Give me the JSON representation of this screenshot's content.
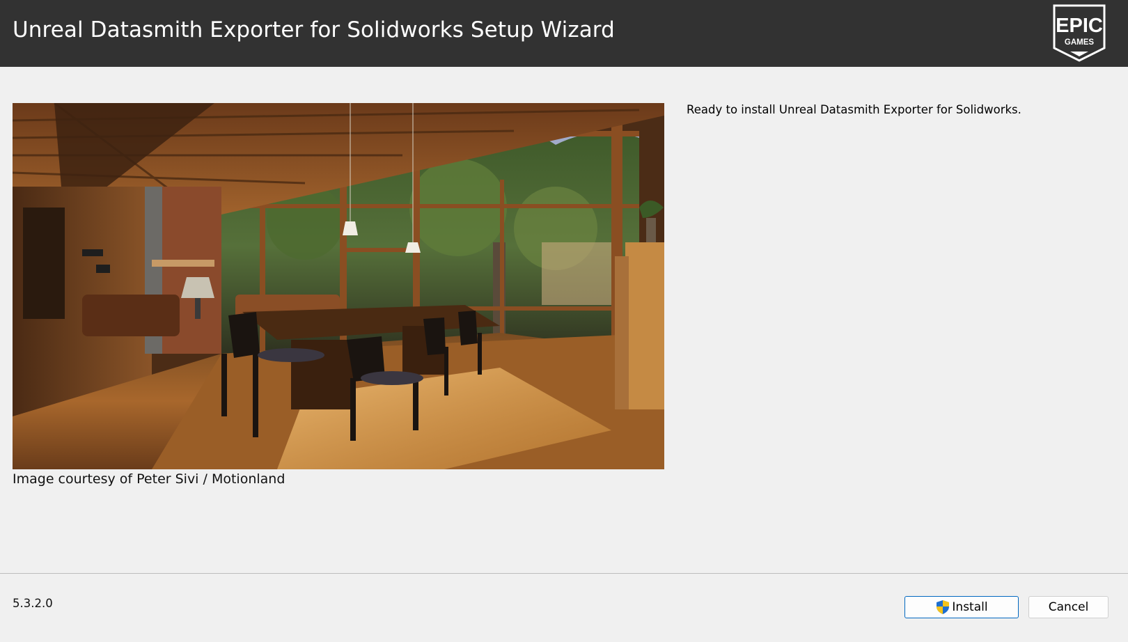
{
  "window": {
    "title": "Unreal Datasmith Exporter for Solidworks Setup Wizard"
  },
  "logo": {
    "line1": "EPIC",
    "line2": "GAMES",
    "icon": "epic-games-logo"
  },
  "hero": {
    "icon": "interior-render-image",
    "caption": "Image courtesy of Peter Sivi / Motionland"
  },
  "main": {
    "status": "Ready to install Unreal Datasmith Exporter for Solidworks."
  },
  "footer": {
    "version": "5.3.2.0",
    "install_label": "Install",
    "install_icon": "uac-shield-icon",
    "cancel_label": "Cancel"
  },
  "colors": {
    "header_bg": "#323232",
    "window_bg": "#f0f0f0",
    "accent": "#0067c0"
  }
}
